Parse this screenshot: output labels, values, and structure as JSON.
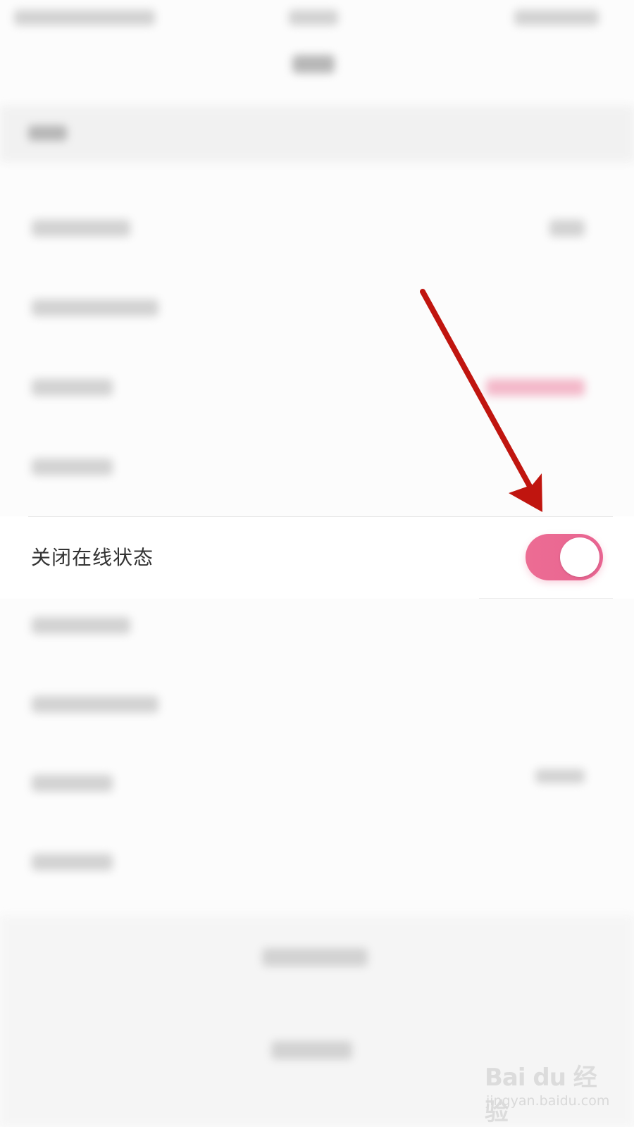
{
  "setting_row": {
    "label": "关闭在线状态",
    "toggle_on": true
  },
  "colors": {
    "toggle_on": "#ec6c93",
    "arrow": "#c0150f",
    "background": "#fcfcfc"
  },
  "watermark": {
    "logo_text": "Bai du 经验",
    "url": "jingyan.baidu.com"
  }
}
